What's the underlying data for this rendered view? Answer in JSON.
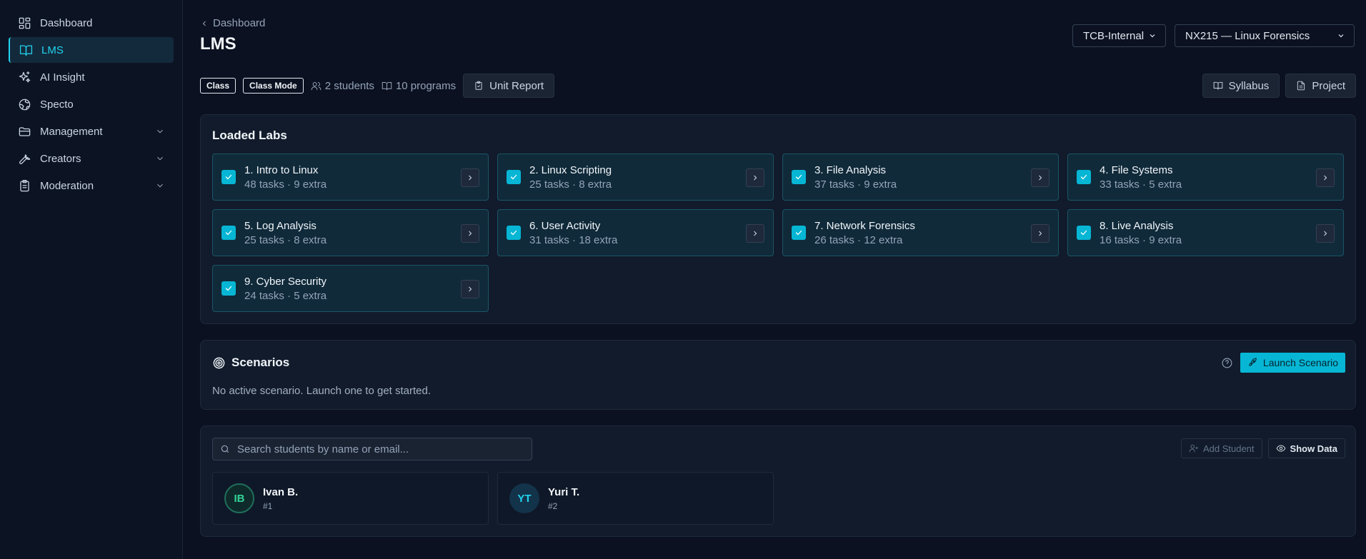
{
  "sidebar": {
    "items": [
      {
        "label": "Dashboard",
        "icon": "dashboard-icon",
        "active": false
      },
      {
        "label": "LMS",
        "icon": "book-icon",
        "active": true
      },
      {
        "label": "AI Insight",
        "icon": "sparkles-icon",
        "active": false
      },
      {
        "label": "Specto",
        "icon": "globe-icon",
        "active": false
      },
      {
        "label": "Management",
        "icon": "folder-icon",
        "expandable": true
      },
      {
        "label": "Creators",
        "icon": "wrench-icon",
        "expandable": true
      },
      {
        "label": "Moderation",
        "icon": "clipboard-icon",
        "expandable": true
      }
    ]
  },
  "header": {
    "breadcrumb": "Dashboard",
    "title": "LMS",
    "org_select": "TCB-Internal",
    "course_select": "NX215 — Linux Forensics"
  },
  "toolbar": {
    "tag_class": "Class",
    "tag_mode": "Class Mode",
    "students": "2 students",
    "programs": "10 programs",
    "unit_report": "Unit Report",
    "syllabus": "Syllabus",
    "project": "Project"
  },
  "labs": {
    "title": "Loaded Labs",
    "items": [
      {
        "name": "1. Intro to Linux",
        "sub": "48 tasks · 9 extra"
      },
      {
        "name": "2. Linux Scripting",
        "sub": "25 tasks · 8 extra"
      },
      {
        "name": "3. File Analysis",
        "sub": "37 tasks · 9 extra"
      },
      {
        "name": "4. File Systems",
        "sub": "33 tasks · 5 extra"
      },
      {
        "name": "5. Log Analysis",
        "sub": "25 tasks · 8 extra"
      },
      {
        "name": "6. User Activity",
        "sub": "31 tasks · 18 extra"
      },
      {
        "name": "7. Network Forensics",
        "sub": "26 tasks · 12 extra"
      },
      {
        "name": "8. Live Analysis",
        "sub": "16 tasks · 9 extra"
      },
      {
        "name": "9. Cyber Security",
        "sub": "24 tasks · 5 extra"
      }
    ]
  },
  "scenarios": {
    "title": "Scenarios",
    "empty_text": "No active scenario. Launch one to get started.",
    "launch_label": "Launch Scenario"
  },
  "students": {
    "search_placeholder": "Search students by name or email...",
    "add_label": "Add Student",
    "show_data_label": "Show Data",
    "list": [
      {
        "initials": "IB",
        "name": "Ivan B.",
        "num": "#1"
      },
      {
        "initials": "YT",
        "name": "Yuri T.",
        "num": "#2"
      }
    ]
  },
  "colors": {
    "accent": "#06b6d4",
    "background": "#0b1120",
    "panel": "#111b2b"
  }
}
